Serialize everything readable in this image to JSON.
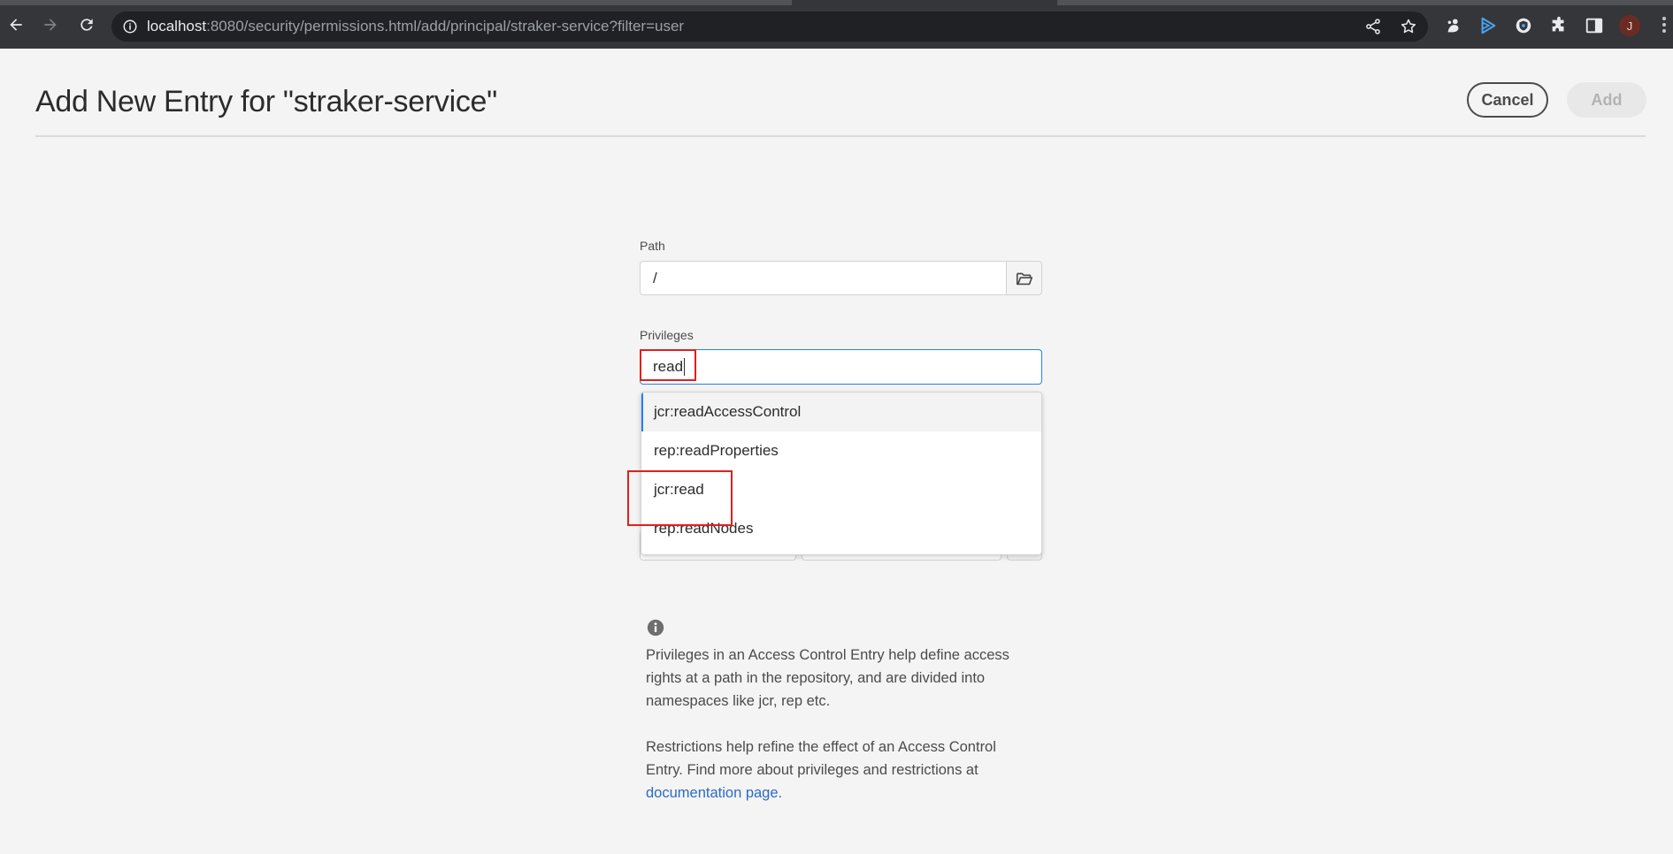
{
  "browser": {
    "url_host": "localhost",
    "url_rest": ":8080/security/permissions.html/add/principal/straker-service?filter=user",
    "profile_initial": "J"
  },
  "header": {
    "title": "Add New Entry for \"straker-service\"",
    "cancel_label": "Cancel",
    "add_label": "Add"
  },
  "form": {
    "path_label": "Path",
    "path_value": "/",
    "privileges_label": "Privileges",
    "privileges_value": "read",
    "suggestions": [
      "jcr:readAccessControl",
      "rep:readProperties",
      "jcr:read",
      "rep:readNodes"
    ]
  },
  "info": {
    "paragraph1": "Privileges in an Access Control Entry help define access rights at a path in the repository, and are divided into namespaces like jcr, rep etc.",
    "paragraph2_prefix": "Restrictions help refine the effect of an Access Control Entry. Find more about privileges and restrictions at ",
    "link_text": "documentation page."
  },
  "colors": {
    "accent": "#2680eb",
    "annotation": "#e0201c",
    "link": "#2b6bc4"
  }
}
